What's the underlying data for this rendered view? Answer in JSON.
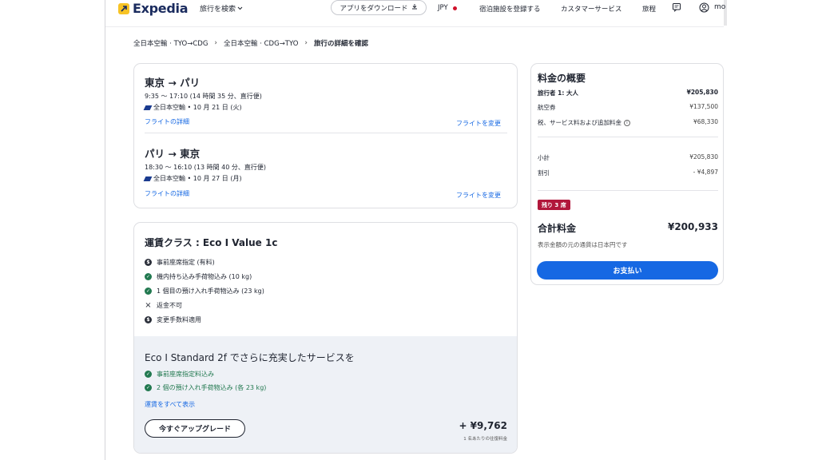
{
  "header": {
    "logo_text": "Expedia",
    "nav_search": "旅行を検索",
    "app_download": "アプリをダウンロード",
    "currency": "JPY",
    "list_property": "宿泊施設を登録する",
    "customer_service": "カスタマーサービス",
    "trips": "旅程",
    "user": "mo"
  },
  "breadcrumb": {
    "step1": "全日本空輸 · TYO→CDG",
    "step2": "全日本空輸 · CDG→TYO",
    "current": "旅行の詳細を確認"
  },
  "flights": [
    {
      "title": "東京 → パリ",
      "time": "9:35 ～ 17:10 (14 時間 35 分、直行便)",
      "airline": "全日本空輸 • 10 月 21 日 (火)",
      "details_link": "フライトの詳細",
      "change_link": "フライトを変更"
    },
    {
      "title": "パリ → 東京",
      "time": "18:30 ～ 16:10 (13 時間 40 分、直行便)",
      "airline": "全日本空輸 • 10 月 27 日 (月)",
      "details_link": "フライトの詳細",
      "change_link": "フライトを変更"
    }
  ],
  "fare": {
    "title": "運賃クラス : Eco I Value 1c",
    "features": [
      {
        "icon": "dollar",
        "text": "事前座席指定 (有料)"
      },
      {
        "icon": "check",
        "text": "機内持ち込み手荷物込み (10 kg)"
      },
      {
        "icon": "check",
        "text": "1 個目の預け入れ手荷物込み (23 kg)"
      },
      {
        "icon": "x",
        "text": "返金不可"
      },
      {
        "icon": "dollar",
        "text": "変更手数料適用"
      }
    ],
    "upgrade": {
      "title": "Eco I Standard 2f でさらに充実したサービスを",
      "features": [
        "事前座席指定料込み",
        "2 個の預け入れ手荷物込み (各 23 kg)"
      ],
      "see_all": "運賃をすべて表示",
      "button": "今すぐアップグレード",
      "price": "+ ¥9,762",
      "price_note": "1 名あたりの往復料金"
    }
  },
  "summary": {
    "title": "料金の概要",
    "traveler_label": "旅行者 1: 大人",
    "traveler_value": "¥205,830",
    "airfare_label": "航空券",
    "airfare_value": "¥137,500",
    "taxes_label": "税、サービス料および追加料金",
    "taxes_value": "¥68,330",
    "subtotal_label": "小計",
    "subtotal_value": "¥205,830",
    "discount_label": "割引",
    "discount_value": "- ¥4,897",
    "badge": "残り 3 席",
    "total_label": "合計料金",
    "total_value": "¥200,933",
    "currency_note": "表示金額の元の通貨は日本円です",
    "pay_button": "お支払い"
  },
  "colors": {
    "accent": "#1668e3",
    "brand_yellow": "#f7c325",
    "badge_red": "#b1173b",
    "success_green": "#227950"
  }
}
